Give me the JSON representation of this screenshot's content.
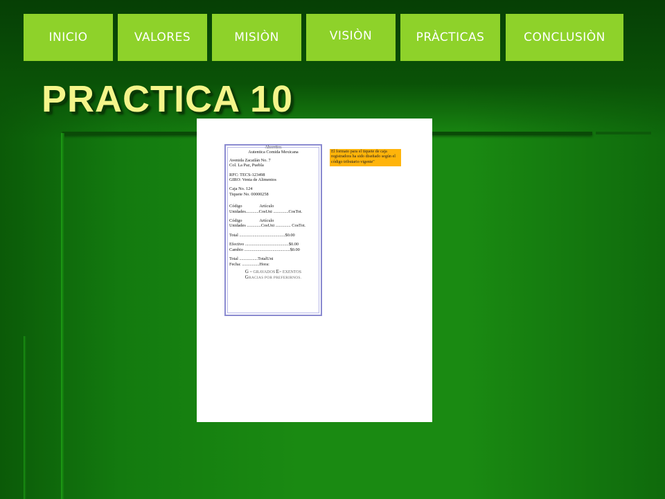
{
  "nav": {
    "items": [
      {
        "label": "INICIO"
      },
      {
        "label": "VALORES"
      },
      {
        "label": "MISIÒN"
      },
      {
        "label": "VISIÒN"
      },
      {
        "label": "PRÀCTICAS"
      },
      {
        "label": "CONCLUSIÒN"
      }
    ]
  },
  "slide": {
    "title": "PRACTICA 10"
  },
  "receipt": {
    "heading1": "Ahorritos",
    "heading2": "Autentica Comida Mexicana",
    "address1": "Avenida Zacatlán No. 7",
    "address2": "Col. La Paz, Puebla",
    "rfc": "RFC: TECS-123498",
    "giro": "GIRO: Venta de Alimentos",
    "caja": "Caja No. 124",
    "tiquete": "Tiquete No. 00000258",
    "item1_line1": "Código                Artículo",
    "item1_line2": "Unidades............CosUni ..............CosTot.",
    "item2_line1": "Código                Artículo",
    "item2_line2": "Unidades .............CosUni .............. CosTot.",
    "total": "Total ..........................................$0.00",
    "efectivo": "Efectivo ........................................$0.00",
    "cambio": "Cambio ..........................................$0.00",
    "total_uni": "Total .................TotalUni",
    "fecha": "Fecha: ................Hora:",
    "legend_g": "G",
    "legend_g_text": " = GRAVADOS ",
    "legend_e": "E",
    "legend_e_text": "= EXENTOS",
    "thanks_g": "G",
    "thanks_text": "RACIAS POR PREFERIRNOS."
  },
  "note": {
    "text": "El formato para el tiquete de caja registradora ha sido diseñado según el código tributario vigente\""
  },
  "colors": {
    "nav_button": "#8ed22a",
    "title": "#f4f58a",
    "note_bg": "#ffb40a"
  }
}
